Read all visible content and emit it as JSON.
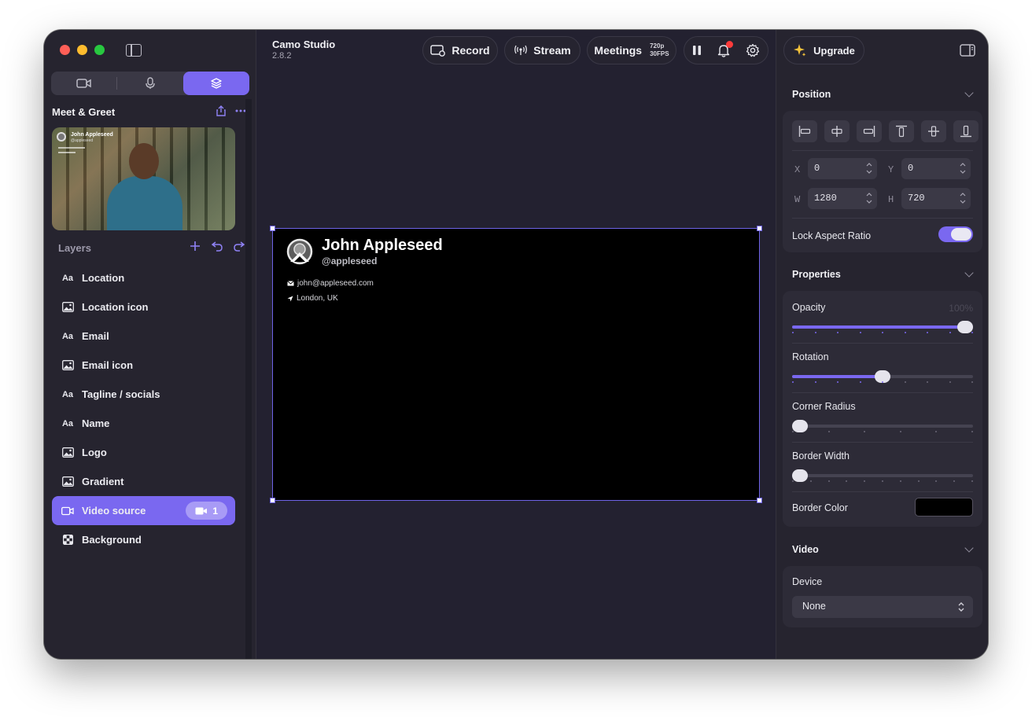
{
  "app": {
    "name": "Camo Studio",
    "version": "2.8.2"
  },
  "toolbar": {
    "record": "Record",
    "stream": "Stream",
    "meetings": "Meetings",
    "resolution": "720p",
    "fps": "30FPS",
    "upgrade": "Upgrade"
  },
  "project": {
    "title": "Meet & Greet"
  },
  "thumbnail": {
    "name": "John Appleseed",
    "handle": "@appleseed"
  },
  "layers": {
    "heading": "Layers",
    "items": [
      {
        "label": "Location",
        "icon": "text-icon"
      },
      {
        "label": "Location icon",
        "icon": "image-icon"
      },
      {
        "label": "Email",
        "icon": "text-icon"
      },
      {
        "label": "Email icon",
        "icon": "image-icon"
      },
      {
        "label": "Tagline / socials",
        "icon": "text-icon"
      },
      {
        "label": "Name",
        "icon": "text-icon"
      },
      {
        "label": "Logo",
        "icon": "image-icon"
      },
      {
        "label": "Gradient",
        "icon": "image-icon"
      },
      {
        "label": "Video source",
        "icon": "video-icon",
        "badge": "1",
        "selected": true
      },
      {
        "label": "Background",
        "icon": "checker-icon"
      }
    ],
    "text_glyph": "Aa"
  },
  "canvas": {
    "name": "John Appleseed",
    "handle": "@appleseed",
    "email": "john@appleseed.com",
    "location": "London, UK"
  },
  "position": {
    "heading": "Position",
    "x_label": "X",
    "x": "0",
    "y_label": "Y",
    "y": "0",
    "w_label": "W",
    "w": "1280",
    "h_label": "H",
    "h": "720",
    "lock_label": "Lock Aspect Ratio",
    "lock_on": true
  },
  "properties": {
    "heading": "Properties",
    "opacity_label": "Opacity",
    "opacity_value": "100%",
    "opacity": 1.0,
    "rotation_label": "Rotation",
    "rotation": 0.5,
    "corner_label": "Corner Radius",
    "corner": 0.0,
    "border_width_label": "Border Width",
    "border_width": 0.0,
    "border_color_label": "Border Color",
    "border_color": "#000000"
  },
  "video": {
    "heading": "Video",
    "device_label": "Device",
    "device": "None"
  },
  "colors": {
    "accent": "#7a68f0",
    "notification": "#ff3b3b"
  }
}
